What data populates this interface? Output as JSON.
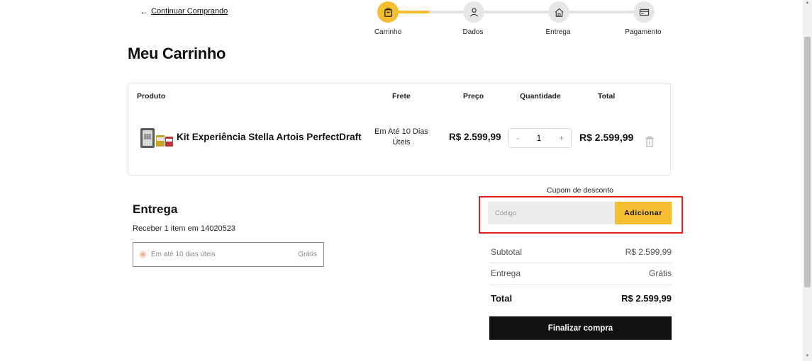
{
  "nav": {
    "back_arrow": "←",
    "back_label": "Continuar Comprando"
  },
  "steps": [
    {
      "label": "Carrinho",
      "icon": "shopping-bag-icon",
      "active": true
    },
    {
      "label": "Dados",
      "icon": "user-icon",
      "active": false
    },
    {
      "label": "Entrega",
      "icon": "home-icon",
      "active": false
    },
    {
      "label": "Pagamento",
      "icon": "credit-card-icon",
      "active": false
    }
  ],
  "page_title": "Meu Carrinho",
  "table": {
    "headers": [
      "Produto",
      "Frete",
      "Preço",
      "Quantidade",
      "Total"
    ],
    "item": {
      "name": "Kit Experiência Stella Artois PerfectDraft",
      "frete": "Em Até 10 Dias Úteis",
      "price": "R$ 2.599,99",
      "qty_minus": "-",
      "quantity": "1",
      "qty_plus": "+",
      "total": "R$ 2.599,99"
    }
  },
  "entrega": {
    "title": "Entrega",
    "subtitle": "Receber 1 item em 14020523",
    "option_label": "Em até 10 dias úteis",
    "option_price": "Grátis"
  },
  "coupon": {
    "label": "Cupom de desconto",
    "placeholder": "Código",
    "button": "Adicionar"
  },
  "summary": {
    "subtotal_label": "Subtotal",
    "subtotal_value": "R$ 2.599,99",
    "entrega_label": "Entrega",
    "entrega_value": "Grátis",
    "total_label": "Total",
    "total_value": "R$ 2.599,99",
    "finish_button": "Finalizar compra"
  },
  "colors": {
    "accent": "#f6bd30",
    "highlight_outline": "#e02020",
    "primary_button": "#111111"
  }
}
